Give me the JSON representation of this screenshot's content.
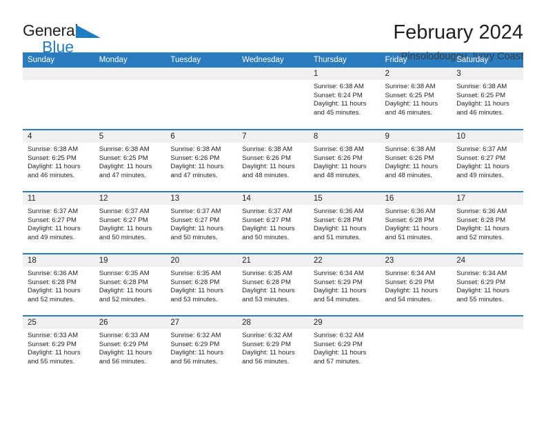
{
  "brand": {
    "name_top": "General",
    "name_bottom": "Blue",
    "triangle_color": "#1f7dc4"
  },
  "header": {
    "title": "February 2024",
    "subtitle": "Pinsolodougou, Ivory Coast"
  },
  "colors": {
    "header_blue": "#2b7cbf",
    "daynum_band": "#f0f0f0",
    "text": "#231f20",
    "brand_blue": "#1f7dc4"
  },
  "weekday_headers": [
    "Sunday",
    "Monday",
    "Tuesday",
    "Wednesday",
    "Thursday",
    "Friday",
    "Saturday"
  ],
  "labels": {
    "sunrise_prefix": "Sunrise:",
    "sunset_prefix": "Sunset:",
    "daylight_prefix": "Daylight:"
  },
  "weeks": [
    [
      {
        "empty": true
      },
      {
        "empty": true
      },
      {
        "empty": true
      },
      {
        "empty": true
      },
      {
        "day": "1",
        "sunrise": "Sunrise: 6:38 AM",
        "sunset": "Sunset: 6:24 PM",
        "daylight": "Daylight: 11 hours and 45 minutes."
      },
      {
        "day": "2",
        "sunrise": "Sunrise: 6:38 AM",
        "sunset": "Sunset: 6:25 PM",
        "daylight": "Daylight: 11 hours and 46 minutes."
      },
      {
        "day": "3",
        "sunrise": "Sunrise: 6:38 AM",
        "sunset": "Sunset: 6:25 PM",
        "daylight": "Daylight: 11 hours and 46 minutes."
      }
    ],
    [
      {
        "day": "4",
        "sunrise": "Sunrise: 6:38 AM",
        "sunset": "Sunset: 6:25 PM",
        "daylight": "Daylight: 11 hours and 46 minutes."
      },
      {
        "day": "5",
        "sunrise": "Sunrise: 6:38 AM",
        "sunset": "Sunset: 6:25 PM",
        "daylight": "Daylight: 11 hours and 47 minutes."
      },
      {
        "day": "6",
        "sunrise": "Sunrise: 6:38 AM",
        "sunset": "Sunset: 6:26 PM",
        "daylight": "Daylight: 11 hours and 47 minutes."
      },
      {
        "day": "7",
        "sunrise": "Sunrise: 6:38 AM",
        "sunset": "Sunset: 6:26 PM",
        "daylight": "Daylight: 11 hours and 48 minutes."
      },
      {
        "day": "8",
        "sunrise": "Sunrise: 6:38 AM",
        "sunset": "Sunset: 6:26 PM",
        "daylight": "Daylight: 11 hours and 48 minutes."
      },
      {
        "day": "9",
        "sunrise": "Sunrise: 6:38 AM",
        "sunset": "Sunset: 6:26 PM",
        "daylight": "Daylight: 11 hours and 48 minutes."
      },
      {
        "day": "10",
        "sunrise": "Sunrise: 6:37 AM",
        "sunset": "Sunset: 6:27 PM",
        "daylight": "Daylight: 11 hours and 49 minutes."
      }
    ],
    [
      {
        "day": "11",
        "sunrise": "Sunrise: 6:37 AM",
        "sunset": "Sunset: 6:27 PM",
        "daylight": "Daylight: 11 hours and 49 minutes."
      },
      {
        "day": "12",
        "sunrise": "Sunrise: 6:37 AM",
        "sunset": "Sunset: 6:27 PM",
        "daylight": "Daylight: 11 hours and 50 minutes."
      },
      {
        "day": "13",
        "sunrise": "Sunrise: 6:37 AM",
        "sunset": "Sunset: 6:27 PM",
        "daylight": "Daylight: 11 hours and 50 minutes."
      },
      {
        "day": "14",
        "sunrise": "Sunrise: 6:37 AM",
        "sunset": "Sunset: 6:27 PM",
        "daylight": "Daylight: 11 hours and 50 minutes."
      },
      {
        "day": "15",
        "sunrise": "Sunrise: 6:36 AM",
        "sunset": "Sunset: 6:28 PM",
        "daylight": "Daylight: 11 hours and 51 minutes."
      },
      {
        "day": "16",
        "sunrise": "Sunrise: 6:36 AM",
        "sunset": "Sunset: 6:28 PM",
        "daylight": "Daylight: 11 hours and 51 minutes."
      },
      {
        "day": "17",
        "sunrise": "Sunrise: 6:36 AM",
        "sunset": "Sunset: 6:28 PM",
        "daylight": "Daylight: 11 hours and 52 minutes."
      }
    ],
    [
      {
        "day": "18",
        "sunrise": "Sunrise: 6:36 AM",
        "sunset": "Sunset: 6:28 PM",
        "daylight": "Daylight: 11 hours and 52 minutes."
      },
      {
        "day": "19",
        "sunrise": "Sunrise: 6:35 AM",
        "sunset": "Sunset: 6:28 PM",
        "daylight": "Daylight: 11 hours and 52 minutes."
      },
      {
        "day": "20",
        "sunrise": "Sunrise: 6:35 AM",
        "sunset": "Sunset: 6:28 PM",
        "daylight": "Daylight: 11 hours and 53 minutes."
      },
      {
        "day": "21",
        "sunrise": "Sunrise: 6:35 AM",
        "sunset": "Sunset: 6:28 PM",
        "daylight": "Daylight: 11 hours and 53 minutes."
      },
      {
        "day": "22",
        "sunrise": "Sunrise: 6:34 AM",
        "sunset": "Sunset: 6:29 PM",
        "daylight": "Daylight: 11 hours and 54 minutes."
      },
      {
        "day": "23",
        "sunrise": "Sunrise: 6:34 AM",
        "sunset": "Sunset: 6:29 PM",
        "daylight": "Daylight: 11 hours and 54 minutes."
      },
      {
        "day": "24",
        "sunrise": "Sunrise: 6:34 AM",
        "sunset": "Sunset: 6:29 PM",
        "daylight": "Daylight: 11 hours and 55 minutes."
      }
    ],
    [
      {
        "day": "25",
        "sunrise": "Sunrise: 6:33 AM",
        "sunset": "Sunset: 6:29 PM",
        "daylight": "Daylight: 11 hours and 55 minutes."
      },
      {
        "day": "26",
        "sunrise": "Sunrise: 6:33 AM",
        "sunset": "Sunset: 6:29 PM",
        "daylight": "Daylight: 11 hours and 56 minutes."
      },
      {
        "day": "27",
        "sunrise": "Sunrise: 6:32 AM",
        "sunset": "Sunset: 6:29 PM",
        "daylight": "Daylight: 11 hours and 56 minutes."
      },
      {
        "day": "28",
        "sunrise": "Sunrise: 6:32 AM",
        "sunset": "Sunset: 6:29 PM",
        "daylight": "Daylight: 11 hours and 56 minutes."
      },
      {
        "day": "29",
        "sunrise": "Sunrise: 6:32 AM",
        "sunset": "Sunset: 6:29 PM",
        "daylight": "Daylight: 11 hours and 57 minutes."
      },
      {
        "empty": true
      },
      {
        "empty": true
      }
    ]
  ]
}
